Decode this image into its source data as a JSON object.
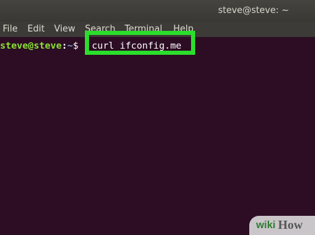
{
  "window": {
    "title": "steve@steve: ~"
  },
  "menu": {
    "items": [
      {
        "label": "File"
      },
      {
        "label": "Edit"
      },
      {
        "label": "View"
      },
      {
        "label": "Search"
      },
      {
        "label": "Terminal"
      },
      {
        "label": "Help"
      }
    ]
  },
  "terminal": {
    "prompt_user": "steve@steve",
    "prompt_sep": ":",
    "prompt_path": "~",
    "prompt_symbol": "$",
    "command": "curl ifconfig.me",
    "background_color": "#2c0d24",
    "highlight_color": "#2bde2b"
  },
  "watermark": {
    "wiki": "wiki",
    "how": "How"
  }
}
